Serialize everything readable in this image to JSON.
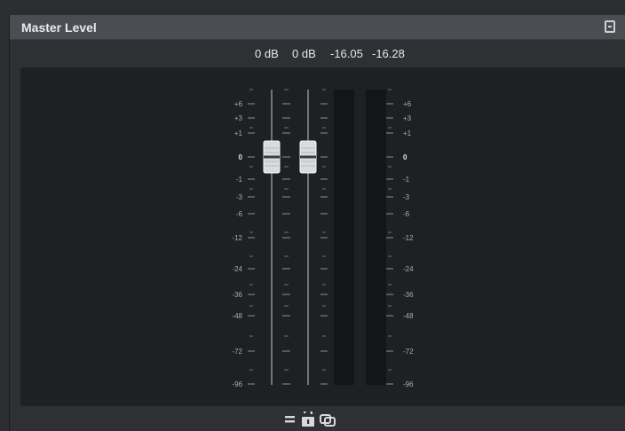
{
  "window": {
    "title": "Master Level"
  },
  "readouts": {
    "left_fader_db": "0 dB",
    "right_fader_db": "0 dB",
    "left_peak": "-16.05",
    "right_peak": "-16.28"
  },
  "scale_labels": [
    "+6",
    "+3",
    "+1",
    "0",
    "-1",
    "-3",
    "-6",
    "-12",
    "-24",
    "-36",
    "-48",
    "-72",
    "-96"
  ],
  "fader_values_db": {
    "left": 0,
    "right": 0
  },
  "icons": {
    "collapse": "collapse-icon",
    "reset": "reset-faders-icon",
    "lock": "unlock-icon",
    "link": "link-channels-icon"
  }
}
